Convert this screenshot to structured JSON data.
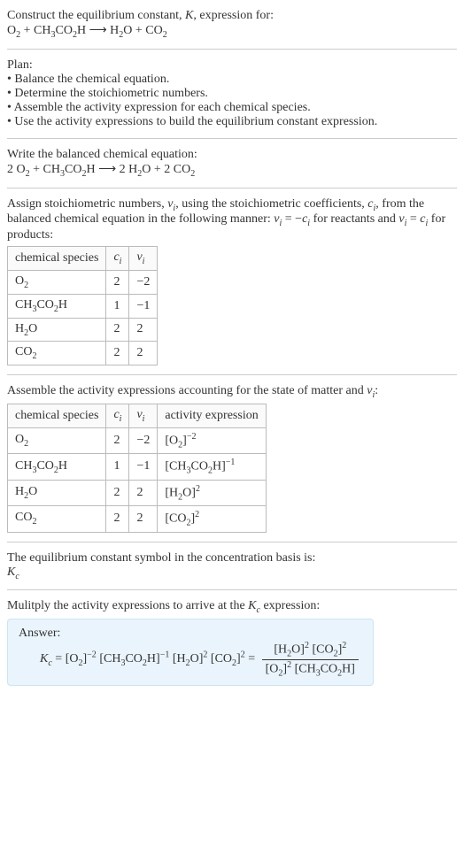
{
  "header": {
    "line1": "Construct the equilibrium constant, ",
    "K": "K",
    "line1b": ", expression for:",
    "eq_lhs_o2": "O",
    "eq_plus": " + ",
    "eq_ch3": "CH",
    "eq_co2h": "CO",
    "eq_h": "H",
    "arrow": " ⟶ ",
    "eq_h2o": "H",
    "eq_o": "O",
    "eq_co2": "CO"
  },
  "plan": {
    "title": "Plan:",
    "l1": "• Balance the chemical equation.",
    "l2": "• Determine the stoichiometric numbers.",
    "l3": "• Assemble the activity expression for each chemical species.",
    "l4": "• Use the activity expressions to build the equilibrium constant expression."
  },
  "balanced": {
    "title": "Write the balanced chemical equation:",
    "c2a": "2 ",
    "c2b": "2 ",
    "c2c": "2 "
  },
  "stoich": {
    "intro1": "Assign stoichiometric numbers, ",
    "nu": "ν",
    "i": "i",
    "intro2": ", using the stoichiometric coefficients, ",
    "c": "c",
    "intro3": ", from the balanced chemical equation in the following manner: ",
    "eq1a": " = −",
    "intro4": " for reactants and ",
    "eq2a": " = ",
    "intro5": " for products:",
    "h_species": "chemical species",
    "h_ci": "c",
    "h_nu": "ν",
    "r1_c": "2",
    "r1_n": "−2",
    "r2_c": "1",
    "r2_n": "−1",
    "r3_c": "2",
    "r3_n": "2",
    "r4_c": "2",
    "r4_n": "2"
  },
  "activity": {
    "title": "Assemble the activity expressions accounting for the state of matter and ",
    "colon": ":",
    "h_species": "chemical species",
    "h_activity": "activity expression",
    "r1_c": "2",
    "r1_n": "−2",
    "r1_exp": "−2",
    "r2_c": "1",
    "r2_n": "−1",
    "r2_exp": "−1",
    "r3_c": "2",
    "r3_n": "2",
    "r3_exp": "2",
    "r4_c": "2",
    "r4_n": "2",
    "r4_exp": "2"
  },
  "symbol": {
    "line": "The equilibrium constant symbol in the concentration basis is:",
    "Kc": "K",
    "c": "c"
  },
  "final": {
    "line": "Mulitply the activity expressions to arrive at the ",
    "line2": " expression:",
    "answer_label": "Answer:",
    "eq": " = ",
    "n2": "−2",
    "n1": "−1",
    "p2": "2"
  },
  "sub2": "2",
  "sub3": "3"
}
